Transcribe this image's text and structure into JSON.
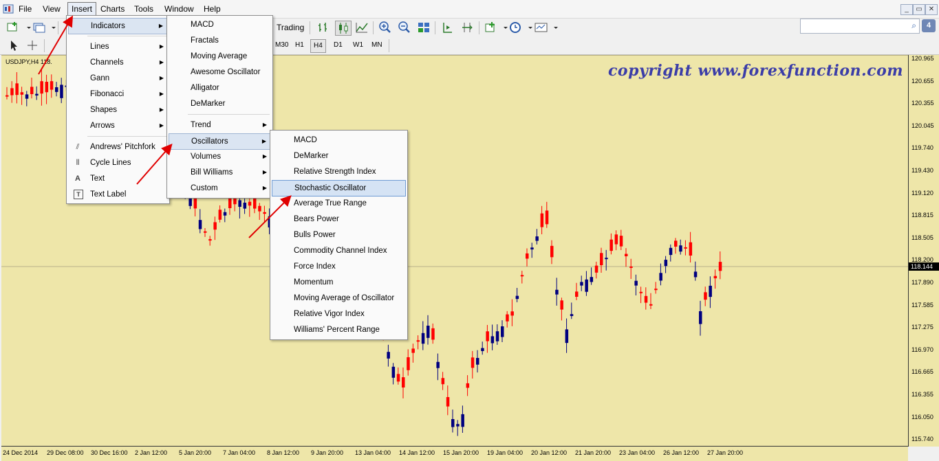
{
  "menubar": {
    "items": [
      "File",
      "View",
      "Insert",
      "Charts",
      "Tools",
      "Window",
      "Help"
    ],
    "active": "Insert"
  },
  "toolbar": {
    "autotrading_label": "Trading",
    "timeframes": [
      "M30",
      "H1",
      "H4",
      "D1",
      "W1",
      "MN"
    ],
    "selected_timeframe": "H4",
    "search_placeholder": ""
  },
  "chart": {
    "symbol_label": "USDJPY,H4 118.",
    "watermark": "copyright www.forexfunction.com",
    "current_price": "118.144",
    "background": "#eee6a9",
    "bull_color": "#000080",
    "bear_color": "#ff0000"
  },
  "chart_data": {
    "type": "candlestick",
    "price_axis_labels": [
      "120.965",
      "120.655",
      "120.355",
      "120.045",
      "119.740",
      "119.430",
      "119.120",
      "118.815",
      "118.505",
      "118.200",
      "117.890",
      "117.585",
      "117.275",
      "116.970",
      "116.665",
      "116.355",
      "116.050",
      "115.740"
    ],
    "time_axis_labels": [
      "24 Dec 2014",
      "29 Dec 08:00",
      "30 Dec 16:00",
      "2 Jan 12:00",
      "5 Jan 20:00",
      "7 Jan 04:00",
      "8 Jan 12:00",
      "9 Jan 20:00",
      "13 Jan 04:00",
      "14 Jan 12:00",
      "15 Jan 20:00",
      "19 Jan 04:00",
      "20 Jan 12:00",
      "21 Jan 20:00",
      "23 Jan 04:00",
      "26 Jan 12:00",
      "27 Jan 20:00"
    ]
  },
  "insert_menu": {
    "items": [
      {
        "label": "Indicators",
        "submenu": true
      },
      {
        "label": "Lines",
        "submenu": true
      },
      {
        "label": "Channels",
        "submenu": true
      },
      {
        "label": "Gann",
        "submenu": true
      },
      {
        "label": "Fibonacci",
        "submenu": true
      },
      {
        "label": "Shapes",
        "submenu": true
      },
      {
        "label": "Arrows",
        "submenu": true
      },
      {
        "label": "Andrews' Pitchfork",
        "icon": "pitchfork-icon"
      },
      {
        "label": "Cycle Lines",
        "icon": "cycle-lines-icon"
      },
      {
        "label": "Text",
        "icon": "text-icon"
      },
      {
        "label": "Text Label",
        "icon": "text-label-icon"
      }
    ]
  },
  "indicators_menu": {
    "items": [
      {
        "label": "MACD"
      },
      {
        "label": "Fractals"
      },
      {
        "label": "Moving Average"
      },
      {
        "label": "Awesome Oscillator"
      },
      {
        "label": "Alligator"
      },
      {
        "label": "DeMarker"
      },
      {
        "label": "Trend",
        "submenu": true
      },
      {
        "label": "Oscillators",
        "submenu": true
      },
      {
        "label": "Volumes",
        "submenu": true
      },
      {
        "label": "Bill Williams",
        "submenu": true
      },
      {
        "label": "Custom",
        "submenu": true
      }
    ]
  },
  "oscillators_menu": {
    "items": [
      {
        "label": "MACD"
      },
      {
        "label": "DeMarker"
      },
      {
        "label": "Relative Strength Index"
      },
      {
        "label": "Stochastic Oscillator"
      },
      {
        "label": "Average True Range"
      },
      {
        "label": "Bears Power"
      },
      {
        "label": "Bulls Power"
      },
      {
        "label": "Commodity Channel Index"
      },
      {
        "label": "Force Index"
      },
      {
        "label": "Momentum"
      },
      {
        "label": "Moving Average of Oscillator"
      },
      {
        "label": "Relative Vigor Index"
      },
      {
        "label": "Williams' Percent Range"
      }
    ],
    "highlighted": "Stochastic Oscillator"
  },
  "annotations": {
    "arrow_color": "#e00000"
  }
}
